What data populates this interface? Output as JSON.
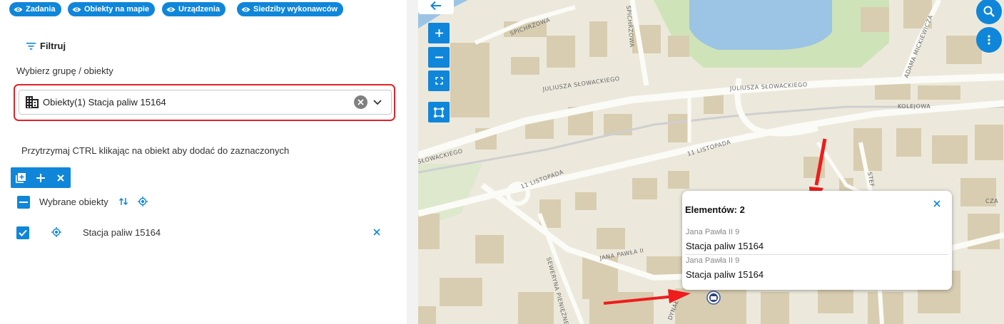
{
  "chips": [
    {
      "label": "Zadania"
    },
    {
      "label": "Obiekty na mapie"
    },
    {
      "label": "Urządzenia"
    },
    {
      "label": "Siedziby wykonawców"
    }
  ],
  "filter": {
    "label": "Filtruj"
  },
  "group_label": "Wybierz grupę / obiekty",
  "select": {
    "value": "Obiekty(1) Stacja paliw 15164"
  },
  "hint": "Przytrzymaj CTRL klikając na obiekt aby dodać do zaznaczonych",
  "selected": {
    "header": "Wybrane obiekty",
    "items": [
      {
        "label": "Stacja paliw 15164",
        "checked": true
      }
    ]
  },
  "map": {
    "streets": [
      "SPICHRZOWA",
      "SPICHRZOWA",
      "JULIUSZA SŁOWACKIEGO",
      "JULIUSZA SŁOWACKIEGO",
      "ADAMA MICKIEWICZA",
      "KOLEJOWA",
      "SŁOWACKIEGO",
      "11 LISTOPADA",
      "11 LISTOPADA",
      "JANA PAWŁA II",
      "SEWERYNA PIENIĘŻNEGO",
      "STEF",
      "CZA",
      "DYNAŁ"
    ],
    "popup": {
      "title": "Elementów: 2",
      "items": [
        {
          "address": "Jana Pawła II 9",
          "name": "Stacja paliw 15164"
        },
        {
          "address": "Jana Pawła II 9",
          "name": "Stacja paliw 15164"
        }
      ]
    }
  },
  "colors": {
    "accent": "#0f86d9",
    "highlight": "#e0232b",
    "water": "#9cc4e4",
    "park": "#cfe3b8"
  }
}
